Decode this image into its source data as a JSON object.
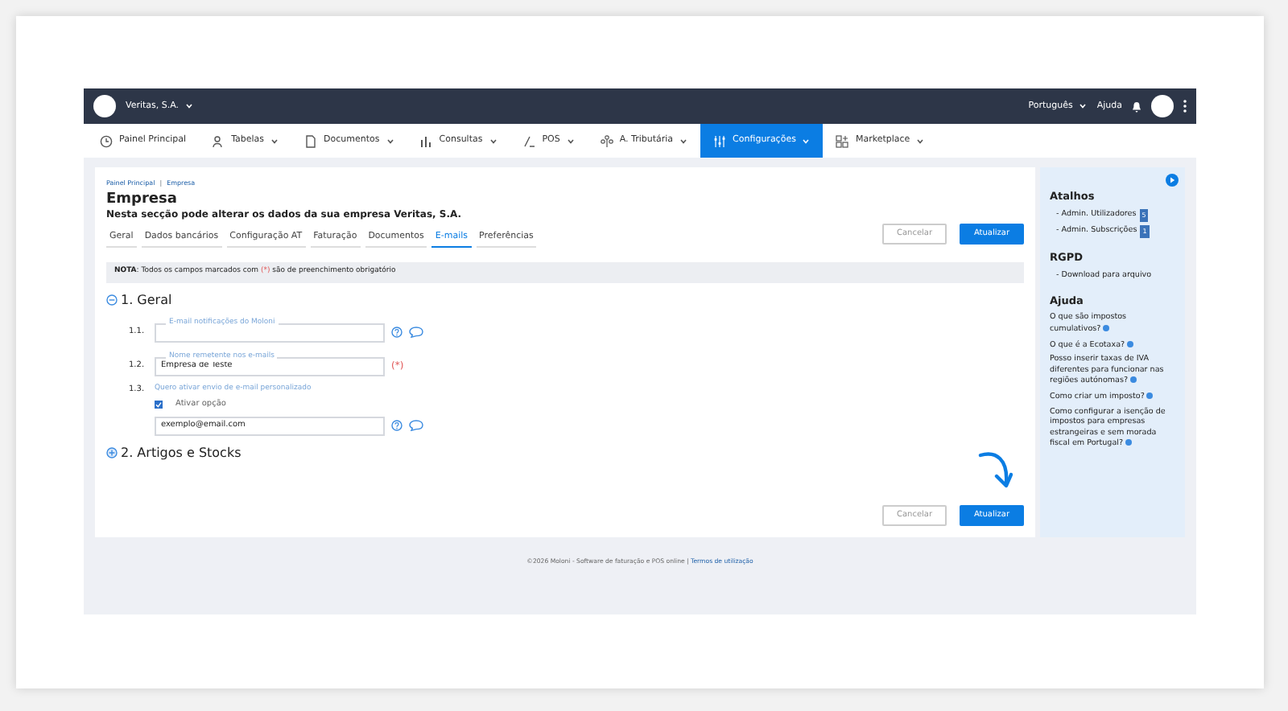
{
  "topbar": {
    "company": "Veritas, S.A.",
    "language": "Português",
    "help": "Ajuda"
  },
  "nav": [
    {
      "label": "Painel Principal",
      "dropdown": false,
      "selected": false
    },
    {
      "label": "Tabelas",
      "dropdown": true,
      "selected": false
    },
    {
      "label": "Documentos",
      "dropdown": true,
      "selected": false
    },
    {
      "label": "Consultas",
      "dropdown": true,
      "selected": false
    },
    {
      "label": "POS",
      "dropdown": true,
      "selected": false
    },
    {
      "label": "A. Tributária",
      "dropdown": true,
      "selected": false
    },
    {
      "label": "Configurações",
      "dropdown": true,
      "selected": true
    },
    {
      "label": "Marketplace",
      "dropdown": true,
      "selected": false
    }
  ],
  "breadcrumb": {
    "items": [
      "Painel Principal",
      "Empresa"
    ],
    "separator": "|"
  },
  "title": "Empresa",
  "subtitle": "Nesta secção pode alterar os dados da sua empresa Veritas, S.A.",
  "tabs": [
    {
      "label": "Geral",
      "selected": false
    },
    {
      "label": "Dados bancários",
      "selected": false
    },
    {
      "label": "Configuração AT",
      "selected": false
    },
    {
      "label": "Faturação",
      "selected": false
    },
    {
      "label": "Documentos",
      "selected": false
    },
    {
      "label": "E-mails",
      "selected": true
    },
    {
      "label": "Preferências",
      "selected": false
    }
  ],
  "top_buttons": [
    {
      "label": "Cancelar",
      "kind": "secondary"
    },
    {
      "label": "Atualizar",
      "kind": "primary"
    }
  ],
  "note": [
    {
      "kind": "bold",
      "text": "NOTA"
    },
    {
      "kind": "plain",
      "text": ": Todos os campos marcados com "
    },
    {
      "kind": "required",
      "text": "(*)"
    },
    {
      "kind": "plain",
      "text": " são de preenchimento obrigatório"
    }
  ],
  "sections": [
    {
      "title": "1. Geral",
      "expanded": true,
      "fields": [
        {
          "number": "1.1.",
          "kind": "text",
          "label": "E-mail notificações do Moloni",
          "help": true
        },
        {
          "number": "1.2.",
          "kind": "text",
          "label": "Nome remetente nos e-mails",
          "value": "Empresa de Teste",
          "required": "(*)",
          "help": false
        },
        {
          "number": "1.3.",
          "kind": "toggle",
          "label": "Quero ativar envio de e-mail personalizado",
          "option": "Ativar opção",
          "checked": true,
          "value": "exemplo@email.com",
          "help": true
        }
      ]
    },
    {
      "title": "2. Artigos e Stocks",
      "expanded": false
    }
  ],
  "bottom_buttons": [
    {
      "label": "Cancelar",
      "kind": "secondary"
    },
    {
      "label": "Atualizar",
      "kind": "primary"
    }
  ],
  "sidebar": {
    "sections": [
      {
        "title": "Atalhos",
        "kind": "bullets",
        "items": [
          {
            "label": "- Admin. Utilizadores",
            "badge": "5"
          },
          {
            "label": "- Admin. Subscrições",
            "badge": "1"
          }
        ]
      },
      {
        "title": "RGPD",
        "kind": "bullets",
        "items": [
          {
            "label": "- Download para arquivo"
          }
        ]
      },
      {
        "title": "Ajuda",
        "kind": "questions",
        "items": [
          {
            "label": "O que são impostos cumulativos?"
          },
          {
            "label": "O que é a Ecotaxa?"
          },
          {
            "label": "Posso inserir taxas de IVA diferentes para funcionar nas regiões autónomas?"
          },
          {
            "label": "Como criar um imposto?"
          },
          {
            "label": "Como configurar a isenção de impostos para empresas estrangeiras e sem morada fiscal em Portugal?"
          }
        ]
      }
    ]
  },
  "footer": {
    "text": "©2026 Moloni - Software de faturação e POS online |",
    "link": "Termos de utilização"
  }
}
